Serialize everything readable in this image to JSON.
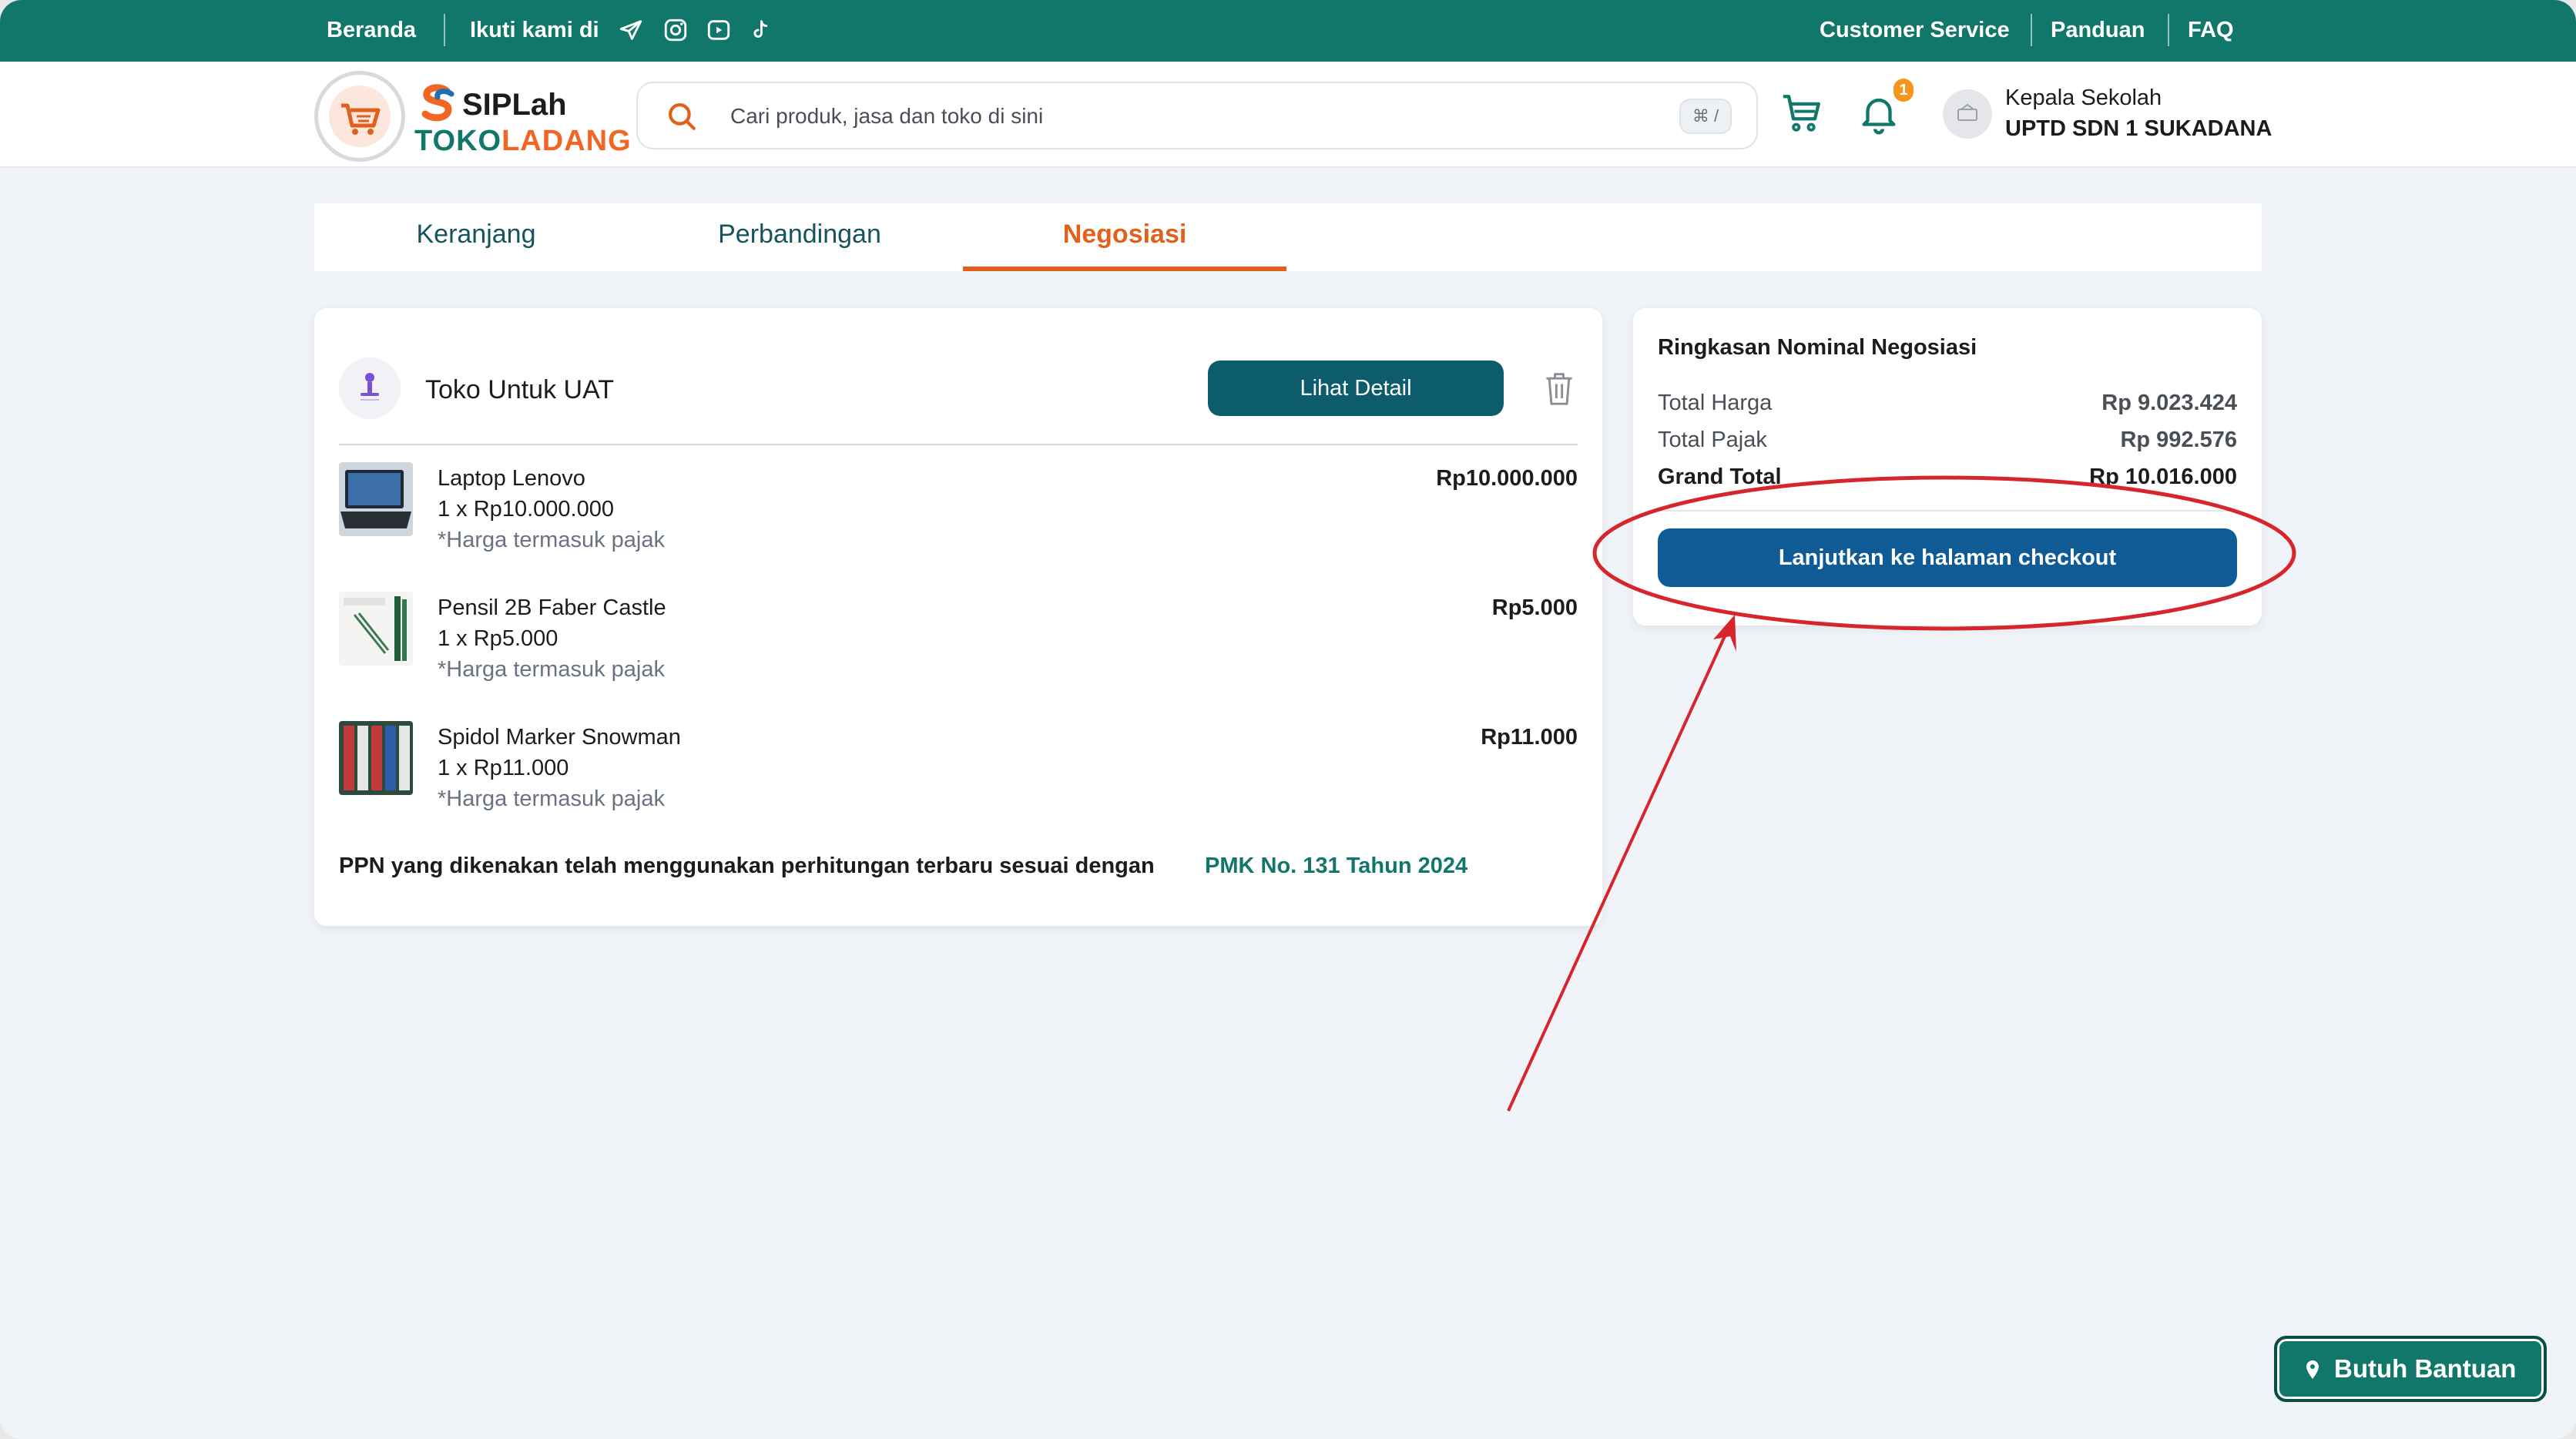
{
  "topbar": {
    "home": "Beranda",
    "follow_us": "Ikuti kami di",
    "social_icons": [
      "telegram-icon",
      "instagram-icon",
      "youtube-icon",
      "tiktok-icon"
    ],
    "customer_service": "Customer Service",
    "guide": "Panduan",
    "faq": "FAQ"
  },
  "header": {
    "logo_top": "SIPLah",
    "logo_bottom_a": "TOKO",
    "logo_bottom_b": "LADANG",
    "search_placeholder": "Cari produk, jasa dan toko di sini",
    "search_shortcut": "⌘ /",
    "notification_count": "1",
    "user_role": "Kepala Sekolah",
    "user_school": "UPTD SDN 1 SUKADANA"
  },
  "tabs": [
    {
      "label": "Keranjang",
      "active": false
    },
    {
      "label": "Perbandingan",
      "active": false
    },
    {
      "label": "Negosiasi",
      "active": true
    }
  ],
  "cart": {
    "store_name": "Toko Untuk UAT",
    "detail_button": "Lihat Detail",
    "items": [
      {
        "name": "Laptop Lenovo",
        "qty": "1 x Rp10.000.000",
        "tax_note": "*Harga termasuk pajak",
        "price": "Rp10.000.000"
      },
      {
        "name": "Pensil 2B Faber Castle",
        "qty": "1 x Rp5.000",
        "tax_note": "*Harga termasuk pajak",
        "price": "Rp5.000"
      },
      {
        "name": "Spidol Marker Snowman",
        "qty": "1 x Rp11.000",
        "tax_note": "*Harga termasuk pajak",
        "price": "Rp11.000"
      }
    ],
    "ppn_note": "PPN yang dikenakan telah menggunakan perhitungan terbaru sesuai dengan",
    "ppn_link": "PMK No. 131 Tahun 2024"
  },
  "summary": {
    "title": "Ringkasan Nominal Negosiasi",
    "total_price_label": "Total Harga",
    "total_price_value": "Rp 9.023.424",
    "total_tax_label": "Total Pajak",
    "total_tax_value": "Rp 992.576",
    "grand_total_label": "Grand Total",
    "grand_total_value": "Rp 10.016.000",
    "checkout_button": "Lanjutkan ke halaman checkout"
  },
  "help": {
    "label": "Butuh Bantuan"
  },
  "colors": {
    "brand_teal": "#12776b",
    "accent_orange": "#e0611c",
    "checkout_blue": "#0e5b96",
    "annotation_red": "#d6252b"
  }
}
